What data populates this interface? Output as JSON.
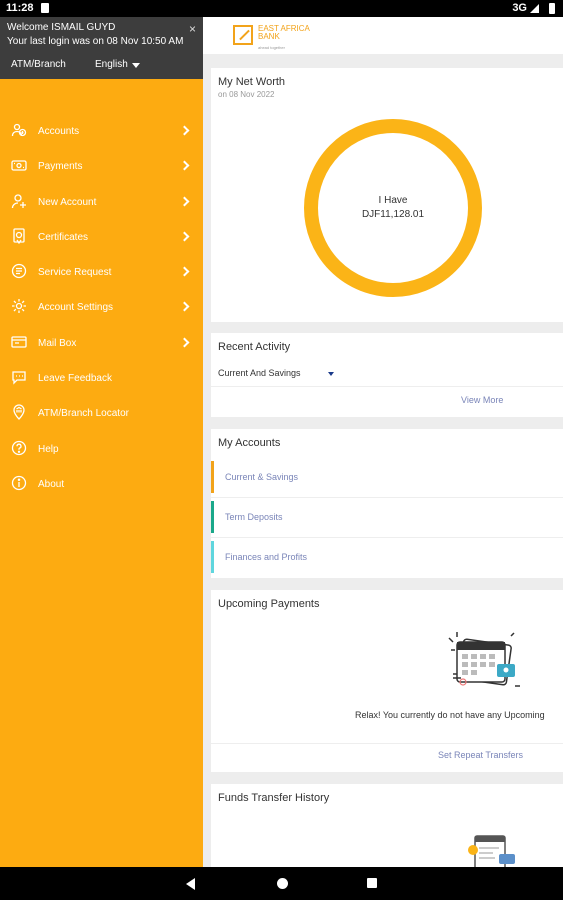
{
  "status": {
    "time": "11:28",
    "network": "3G"
  },
  "drawer": {
    "welcome": "Welcome ISMAIL GUYD",
    "last_login": "Your last login was on 08 Nov 10:50 AM",
    "close": "×",
    "atm_label": "ATM/Branch",
    "language": "English",
    "items": [
      {
        "label": "Accounts",
        "icon": "accounts-icon",
        "chevron": true
      },
      {
        "label": "Payments",
        "icon": "payments-icon",
        "chevron": true
      },
      {
        "label": "New Account",
        "icon": "new-account-icon",
        "chevron": true
      },
      {
        "label": "Certificates",
        "icon": "certificates-icon",
        "chevron": true
      },
      {
        "label": "Service Request",
        "icon": "service-request-icon",
        "chevron": true
      },
      {
        "label": "Account Settings",
        "icon": "settings-gear-icon",
        "chevron": true
      },
      {
        "label": "Mail Box",
        "icon": "mail-box-icon",
        "chevron": true
      },
      {
        "label": "Leave Feedback",
        "icon": "feedback-icon",
        "chevron": false
      },
      {
        "label": "ATM/Branch Locator",
        "icon": "bank-building-icon",
        "chevron": false
      },
      {
        "label": "Help",
        "icon": "help-icon",
        "chevron": false
      },
      {
        "label": "About",
        "icon": "info-icon",
        "chevron": false
      }
    ]
  },
  "header": {
    "logo_name": "EAST AFRICA BANK",
    "logo_tagline": "ahead together"
  },
  "networth": {
    "title": "My Net Worth",
    "date": "on 08 Nov 2022",
    "have_label": "I Have",
    "amount": "DJF11,128.01"
  },
  "recent_activity": {
    "title": "Recent Activity",
    "selected": "Current And Savings",
    "view_more": "View More"
  },
  "my_accounts": {
    "title": "My Accounts",
    "rows": [
      {
        "label": "Current & Savings",
        "color": "#f2a31a"
      },
      {
        "label": "Term Deposits",
        "color": "#1aa88a"
      },
      {
        "label": "Finances and Profits",
        "color": "#5fd6de"
      }
    ]
  },
  "upcoming_payments": {
    "title": "Upcoming Payments",
    "empty_text": "Relax! You currently do not have any Upcoming",
    "set_repeat": "Set Repeat Transfers"
  },
  "funds_transfer": {
    "title": "Funds Transfer History"
  },
  "colors": {
    "drawer": "#fdab11",
    "accent": "#fbb417",
    "link": "#7a85b8",
    "header": "#3d3d3d"
  }
}
